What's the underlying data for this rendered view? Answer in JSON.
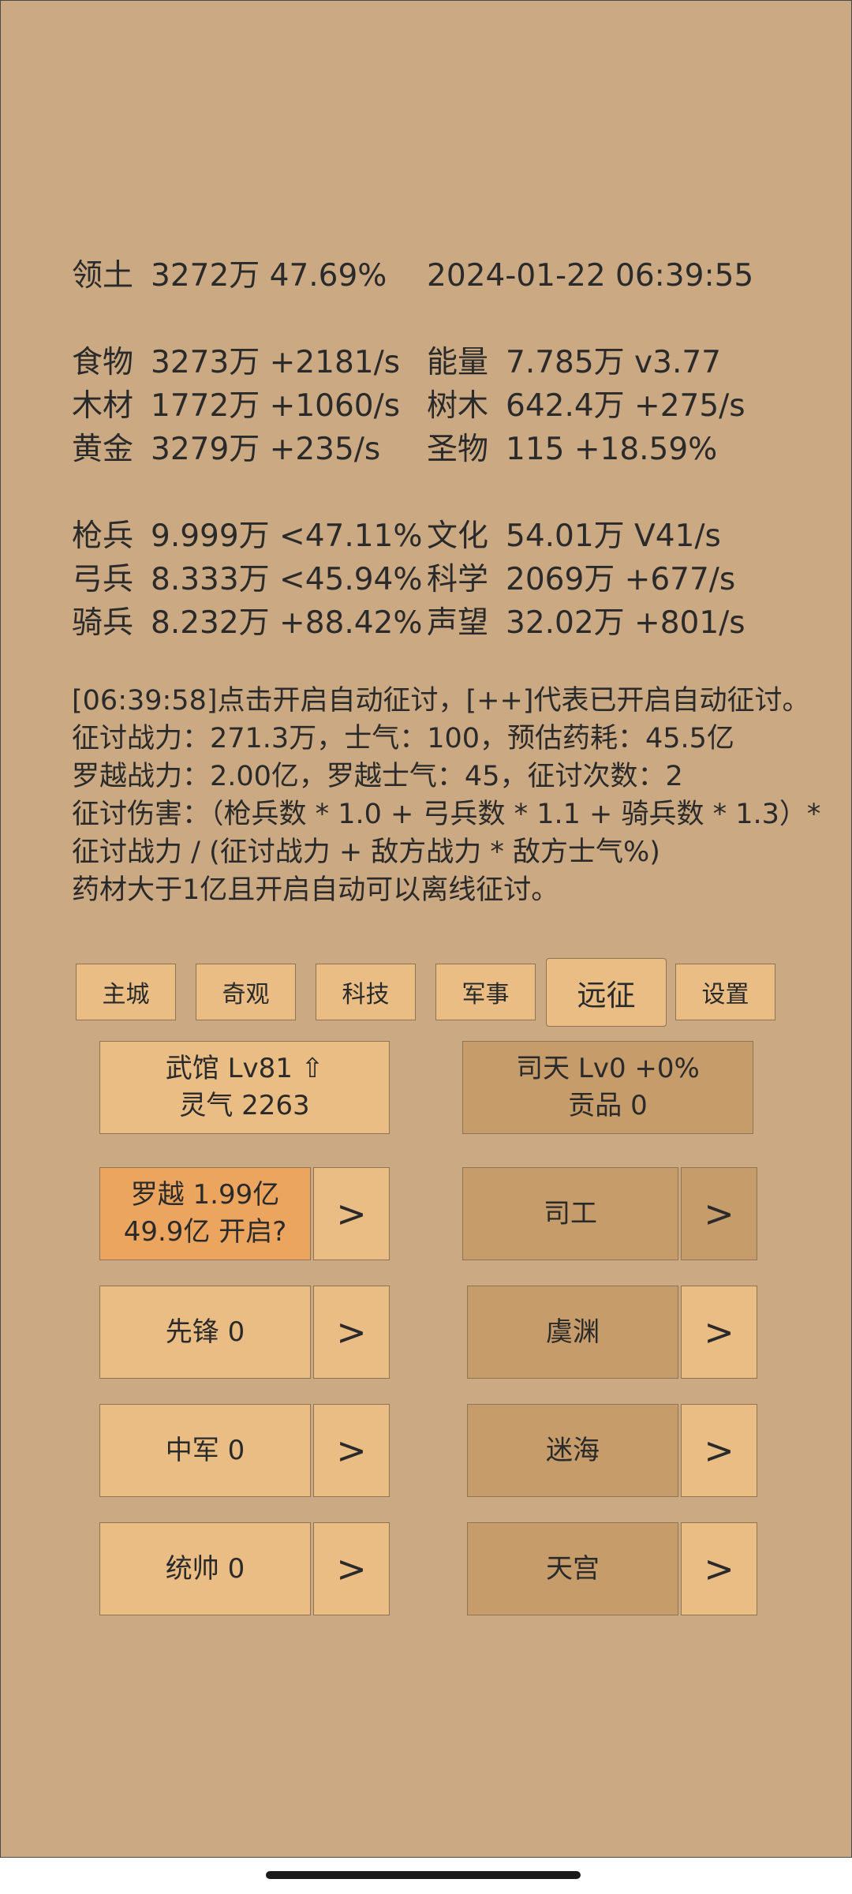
{
  "header": {
    "territory_label": "领土",
    "territory_value": "3272万  47.69%",
    "datetime": "2024-01-22 06:39:55"
  },
  "resources": {
    "col1": [
      {
        "label": "食物",
        "value": "3273万 +2181/s"
      },
      {
        "label": "木材",
        "value": "1772万 +1060/s"
      },
      {
        "label": "黄金",
        "value": "3279万 +235/s"
      }
    ],
    "col2": [
      {
        "label": "能量",
        "value": "7.785万  v3.77"
      },
      {
        "label": "树木",
        "value": "642.4万 +275/s"
      },
      {
        "label": "圣物",
        "value": "115 +18.59%"
      }
    ]
  },
  "troops": {
    "col1": [
      {
        "label": "枪兵",
        "value": "9.999万 <47.11%"
      },
      {
        "label": "弓兵",
        "value": "8.333万 <45.94%"
      },
      {
        "label": "骑兵",
        "value": "8.232万 +88.42%"
      }
    ],
    "col2": [
      {
        "label": "文化",
        "value": "54.01万 V41/s"
      },
      {
        "label": "科学",
        "value": "2069万 +677/s"
      },
      {
        "label": "声望",
        "value": "32.02万 +801/s"
      }
    ]
  },
  "info_lines": [
    "[06:39:58]点击开启自动征讨，[++]代表已开启自动征讨。",
    "征讨战力：271.3万，士气：100，预估药耗：45.5亿",
    "罗越战力：2.00亿，罗越士气：45，征讨次数：2",
    "征讨伤害：（枪兵数 * 1.0 + 弓兵数 * 1.1 + 骑兵数 * 1.3）*",
    "征讨战力 / (征讨战力 + 敌方战力 * 敌方士气%)",
    "药材大于1亿且开启自动可以离线征讨。"
  ],
  "tabs": [
    "主城",
    "奇观",
    "科技",
    "军事",
    "远征",
    "设置"
  ],
  "wuguan": {
    "line1": "武馆 Lv81 ⇧",
    "line2": "灵气 2263"
  },
  "sitian": {
    "line1": "司天 Lv0 +0%",
    "line2": "贡品 0"
  },
  "luoyue": {
    "line1": "罗越  1.99亿",
    "line2": "49.9亿 开启?"
  },
  "left_buttons": [
    "先锋  0",
    "中军  0",
    "统帅  0"
  ],
  "right_buttons": [
    "司工",
    "虞渊",
    "迷海",
    "天宫"
  ],
  "arrow": ">"
}
